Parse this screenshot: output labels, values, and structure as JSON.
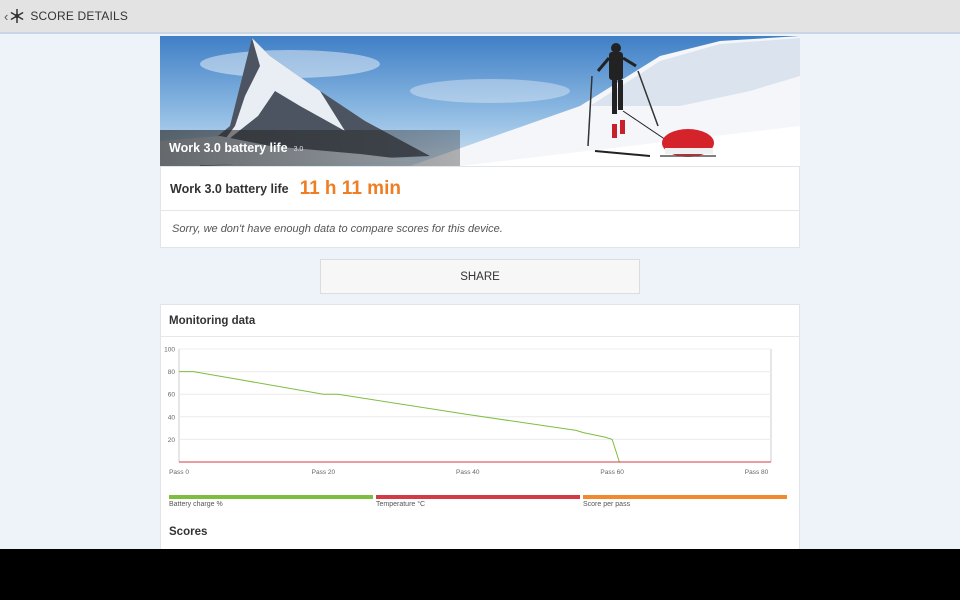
{
  "header": {
    "title": "SCORE DETAILS",
    "back_icon": "chevron-left-icon",
    "app_icon": "snowflake-icon"
  },
  "hero": {
    "title": "Work 3.0 battery life",
    "version": "3.0"
  },
  "score": {
    "label": "Work 3.0 battery life",
    "value": "11 h 11 min",
    "accent": "#f07d22"
  },
  "note": "Sorry, we don't have enough data to compare scores for this device.",
  "share_label": "SHARE",
  "monitoring": {
    "title": "Monitoring data",
    "legend": [
      {
        "label": "Battery charge %",
        "color": "#7cbf3f"
      },
      {
        "label": "Temperature °C",
        "color": "#d33a45"
      },
      {
        "label": "Score per pass",
        "color": "#f08a2c"
      }
    ]
  },
  "scores_title": "Scores",
  "chart_data": {
    "type": "line",
    "x_ticks": [
      "Pass 0",
      "Pass 20",
      "Pass 40",
      "Pass 60",
      "Pass 80"
    ],
    "y_ticks": [
      "100",
      "80",
      "60",
      "40",
      "20"
    ],
    "ylim": [
      0,
      100
    ],
    "xlim": [
      0,
      82
    ],
    "grid": true,
    "legend_position": "bottom",
    "series": [
      {
        "name": "Battery charge %",
        "color": "#7cbf3f",
        "x": [
          0,
          2,
          20,
          22,
          40,
          55,
          56,
          59,
          60,
          61
        ],
        "y": [
          80,
          80,
          60,
          60,
          42,
          28,
          26,
          22,
          20,
          0
        ]
      },
      {
        "name": "Temperature °C",
        "color": "#d33a45",
        "x": [
          0,
          82
        ],
        "y": [
          0,
          0
        ]
      }
    ]
  }
}
